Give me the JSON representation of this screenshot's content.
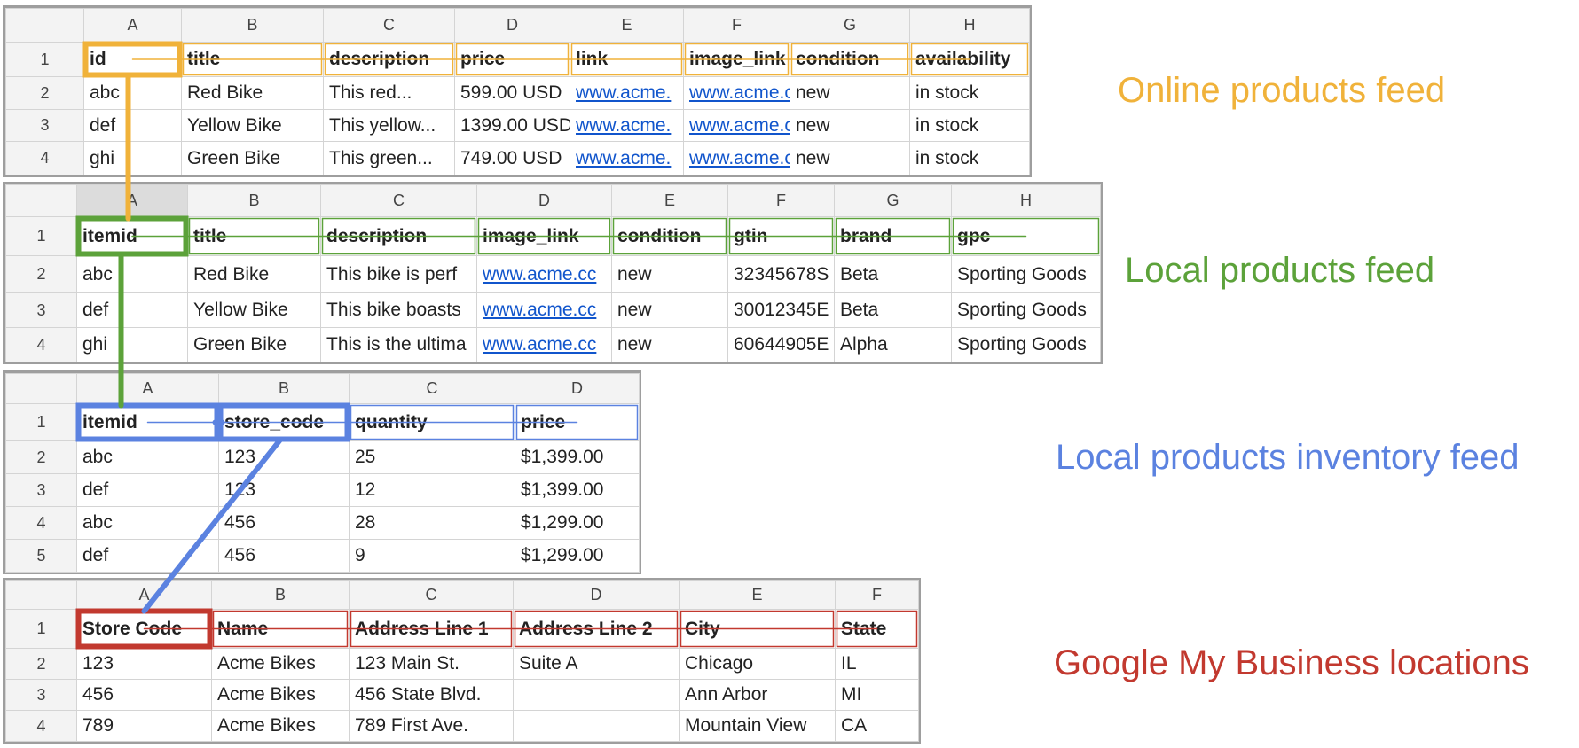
{
  "sheets": [
    {
      "id": "online",
      "label": "Online products feed",
      "color": "#f0b23a",
      "headers": [
        "A",
        "B",
        "C",
        "D",
        "E",
        "F",
        "G",
        "H"
      ],
      "rownums": [
        "1",
        "2",
        "3",
        "4"
      ],
      "columns": [
        "id",
        "title",
        "description",
        "price",
        "link",
        "image_link",
        "condition",
        "availability"
      ],
      "rows": [
        [
          "abc",
          "Red Bike",
          "This red...",
          "599.00 USD",
          "www.acme.",
          "www.acme.co",
          "new",
          "in stock"
        ],
        [
          "def",
          "Yellow Bike",
          "This yellow...",
          "1399.00 USD",
          "www.acme.",
          "www.acme.co",
          "new",
          "in stock"
        ],
        [
          "ghi",
          "Green Bike",
          "This green...",
          "749.00 USD",
          "www.acme.",
          "www.acme.co",
          "new",
          "in stock"
        ]
      ],
      "link_columns": [
        4,
        5
      ]
    },
    {
      "id": "local",
      "label": "Local products feed",
      "color": "#5ca23a",
      "headers": [
        "A",
        "B",
        "C",
        "D",
        "E",
        "F",
        "G",
        "H"
      ],
      "rownums": [
        "1",
        "2",
        "3",
        "4"
      ],
      "columns": [
        "itemid",
        "title",
        "description",
        "image_link",
        "condition",
        "gtin",
        "brand",
        "gpc"
      ],
      "rows": [
        [
          "abc",
          "Red Bike",
          "This bike is perf",
          "www.acme.cc",
          "new",
          "32345678S",
          "Beta",
          "Sporting Goods"
        ],
        [
          "def",
          "Yellow Bike",
          "This bike boasts",
          "www.acme.cc",
          "new",
          "30012345E",
          "Beta",
          "Sporting Goods"
        ],
        [
          "ghi",
          "Green Bike",
          "This is the ultima",
          "www.acme.cc",
          "new",
          "60644905E",
          "Alpha",
          "Sporting Goods"
        ]
      ],
      "link_columns": [
        3
      ]
    },
    {
      "id": "inventory",
      "label": "Local products inventory feed",
      "color": "#5b82e0",
      "headers": [
        "A",
        "B",
        "C",
        "D"
      ],
      "rownums": [
        "1",
        "2",
        "3",
        "4",
        "5"
      ],
      "columns": [
        "itemid",
        "store_code",
        "quantity",
        "price"
      ],
      "rows": [
        [
          "abc",
          "123",
          "25",
          "$1,399.00"
        ],
        [
          "def",
          "123",
          "12",
          "$1,399.00"
        ],
        [
          "abc",
          "456",
          "28",
          "$1,299.00"
        ],
        [
          "def",
          "456",
          "9",
          "$1,299.00"
        ]
      ],
      "link_columns": []
    },
    {
      "id": "gmb",
      "label": "Google My Business locations",
      "color": "#c2392f",
      "headers": [
        "A",
        "B",
        "C",
        "D",
        "E",
        "F"
      ],
      "rownums": [
        "1",
        "2",
        "3",
        "4"
      ],
      "columns": [
        "Store Code",
        "Name",
        "Address Line 1",
        "Address Line 2",
        "City",
        "State"
      ],
      "rows": [
        [
          "123",
          "Acme Bikes",
          "123 Main St.",
          "Suite A",
          "Chicago",
          "IL"
        ],
        [
          "456",
          "Acme Bikes",
          "456 State Blvd.",
          "",
          "Ann Arbor",
          "MI"
        ],
        [
          "789",
          "Acme Bikes",
          "789 First Ave.",
          "",
          "Mountain View",
          "CA"
        ]
      ],
      "link_columns": []
    }
  ]
}
